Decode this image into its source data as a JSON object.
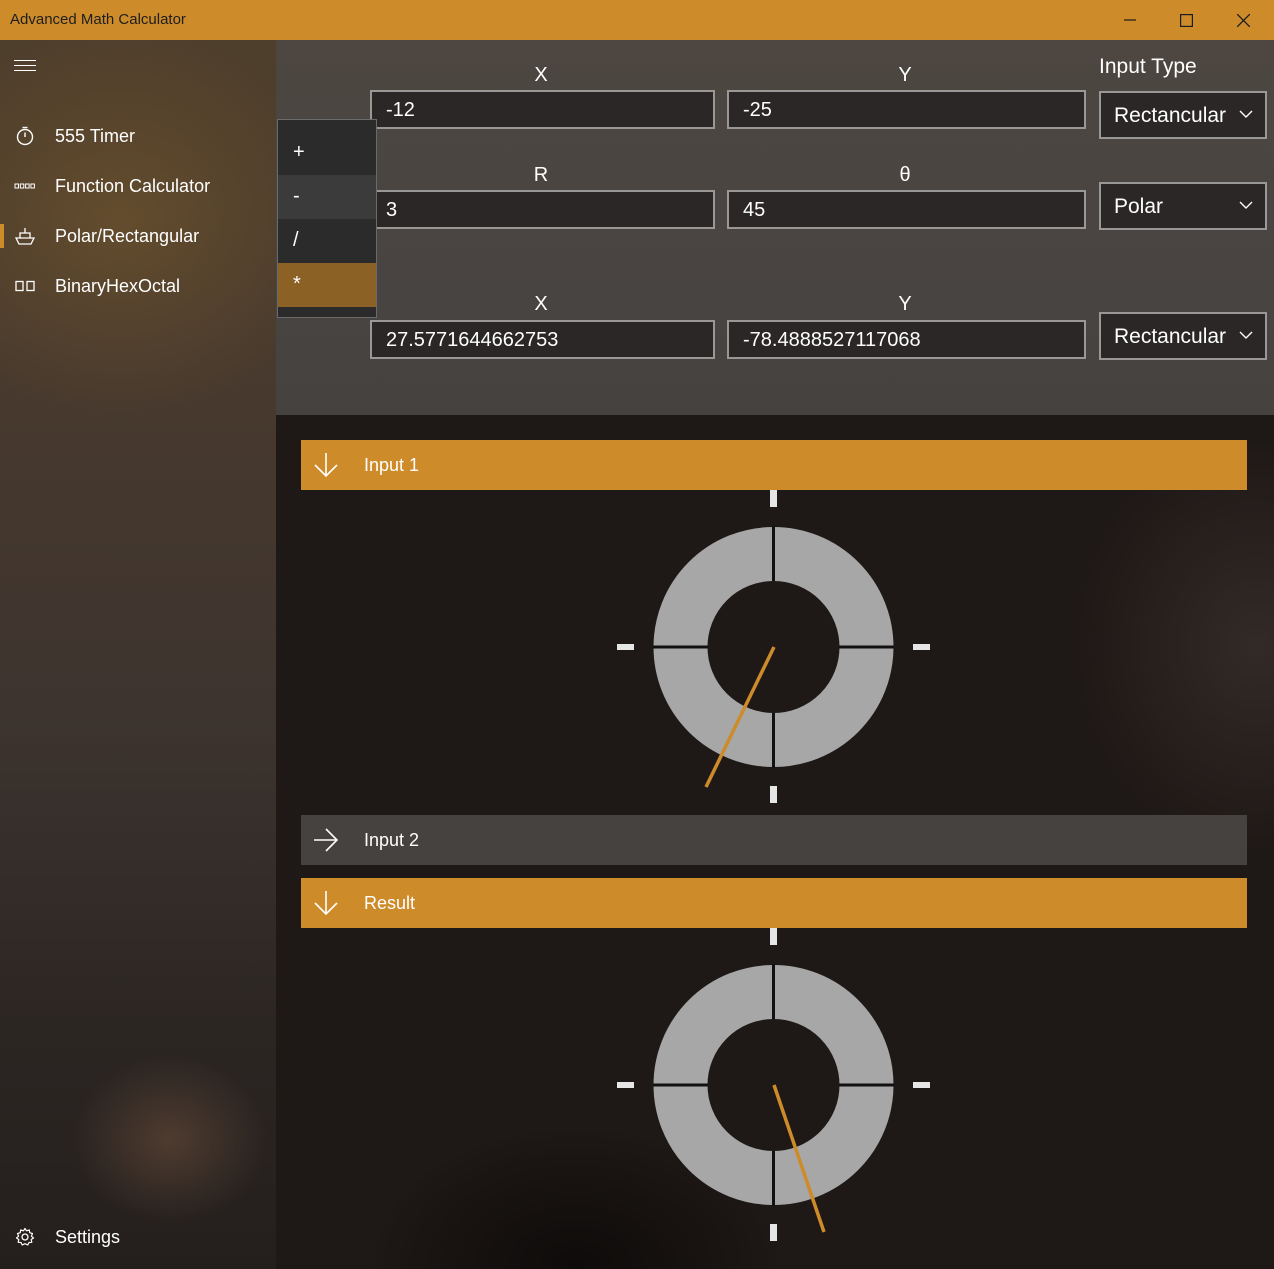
{
  "window": {
    "title": "Advanced Math Calculator"
  },
  "sidebar": {
    "items": [
      {
        "label": "555 Timer",
        "icon": "stopwatch-icon"
      },
      {
        "label": "Function Calculator",
        "icon": "dots-icon"
      },
      {
        "label": "Polar/Rectangular",
        "icon": "ship-icon",
        "selected": true
      },
      {
        "label": "BinaryHexOctal",
        "icon": "two-boxes-icon"
      }
    ],
    "settings_label": "Settings"
  },
  "inputs": {
    "input_type_label": "Input Type",
    "row1": {
      "label_a": "X",
      "label_b": "Y",
      "value_a": "-12",
      "value_b": "-25",
      "type": "Rectancular"
    },
    "row2": {
      "label_a": "R",
      "label_b": "θ",
      "value_a": "3",
      "value_b": "45",
      "type": "Polar"
    },
    "result": {
      "label_a": "X",
      "label_b": "Y",
      "value_a": "27.5771644662753",
      "value_b": "-78.4888527117068",
      "type": "Rectancular"
    }
  },
  "operator_menu": {
    "options": [
      "+",
      "-",
      "/",
      "*"
    ],
    "hovered": "-",
    "selected": "*"
  },
  "sections": {
    "input1": {
      "label": "Input 1",
      "expanded": true
    },
    "input2": {
      "label": "Input 2",
      "expanded": false
    },
    "result": {
      "label": "Result",
      "expanded": true
    }
  },
  "colors": {
    "accent": "#cd8b2a",
    "ring": "#a7a7a7",
    "bar_collapsed": "#454240"
  }
}
